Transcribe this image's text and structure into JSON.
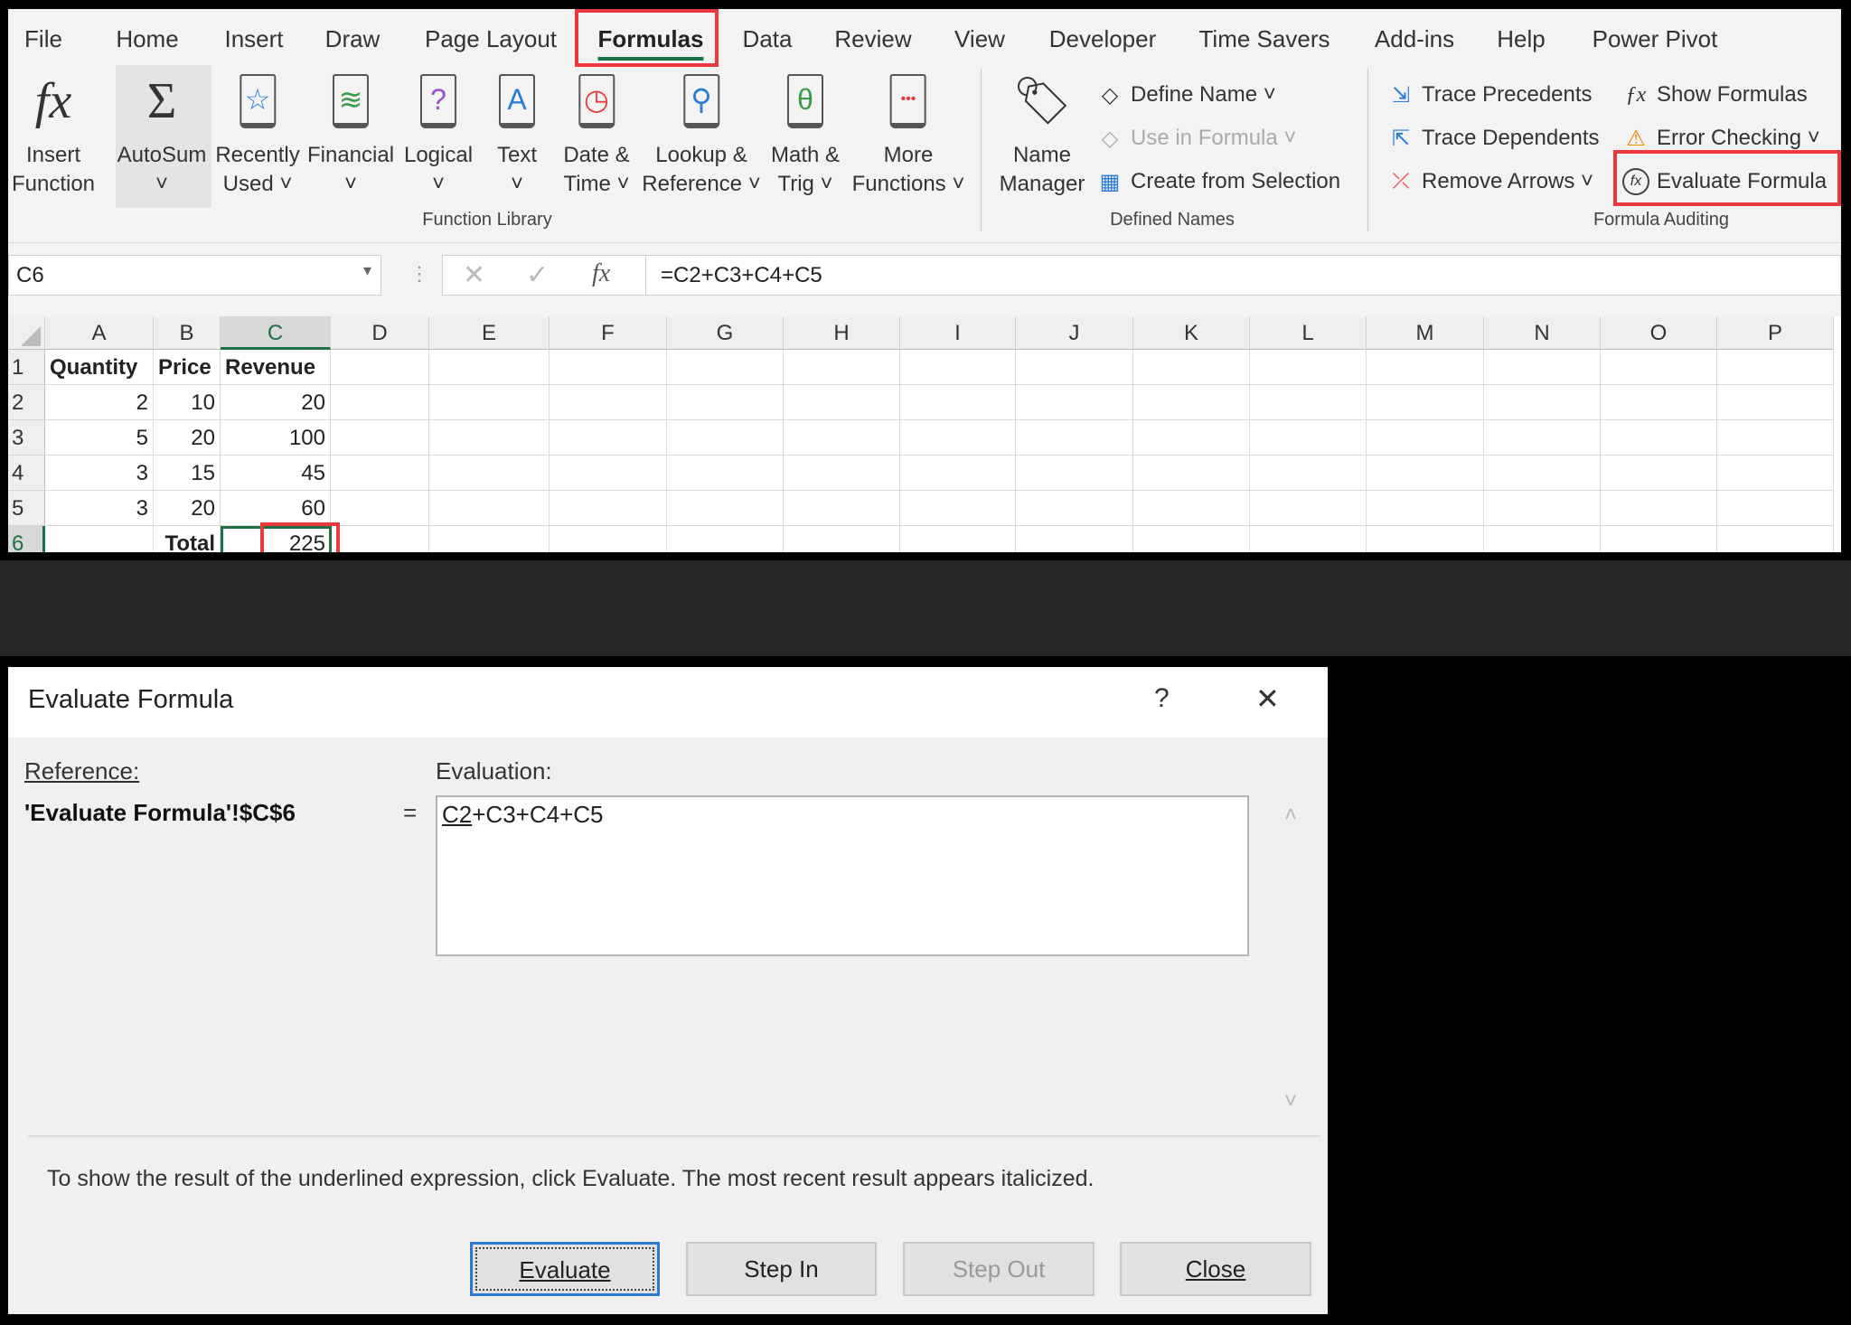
{
  "ribbon_tabs": [
    "File",
    "Home",
    "Insert",
    "Draw",
    "Page Layout",
    "Formulas",
    "Data",
    "Review",
    "View",
    "Developer",
    "Time Savers",
    "Add-ins",
    "Help",
    "Power Pivot"
  ],
  "active_tab": "Formulas",
  "function_library": {
    "group_label": "Function Library",
    "buttons": [
      {
        "l1": "Insert",
        "l2": "Function",
        "icon": "fx-icon"
      },
      {
        "l1": "AutoSum",
        "l2": "˅",
        "icon": "sigma-icon"
      },
      {
        "l1": "Recently",
        "l2": "Used ˅",
        "icon": "star-book-icon"
      },
      {
        "l1": "Financial",
        "l2": "˅",
        "icon": "coins-book-icon"
      },
      {
        "l1": "Logical",
        "l2": "˅",
        "icon": "question-book-icon"
      },
      {
        "l1": "Text",
        "l2": "˅",
        "icon": "text-book-icon"
      },
      {
        "l1": "Date &",
        "l2": "Time ˅",
        "icon": "clock-book-icon"
      },
      {
        "l1": "Lookup &",
        "l2": "Reference ˅",
        "icon": "magnifier-book-icon"
      },
      {
        "l1": "Math &",
        "l2": "Trig ˅",
        "icon": "theta-book-icon"
      },
      {
        "l1": "More",
        "l2": "Functions ˅",
        "icon": "dots-book-icon"
      }
    ]
  },
  "defined_names": {
    "group_label": "Defined Names",
    "name_manager": {
      "l1": "Name",
      "l2": "Manager"
    },
    "define_name": "Define Name ˅",
    "use_in_formula": "Use in Formula ˅",
    "create_from_selection": "Create from Selection"
  },
  "formula_auditing": {
    "group_label": "Formula Auditing",
    "trace_precedents": "Trace Precedents",
    "trace_dependents": "Trace Dependents",
    "remove_arrows": "Remove Arrows ˅",
    "show_formulas": "Show Formulas",
    "error_checking": "Error Checking ˅",
    "evaluate_formula": "Evaluate Formula"
  },
  "name_box": "C6",
  "formula": "=C2+C3+C4+C5",
  "columns": [
    "A",
    "B",
    "C",
    "D",
    "E",
    "F",
    "G",
    "H",
    "I",
    "J",
    "K",
    "L",
    "M",
    "N",
    "O",
    "P"
  ],
  "selected_column": "C",
  "rows": [
    {
      "n": "1",
      "cells": [
        "Quantity",
        "Price",
        "Revenue"
      ]
    },
    {
      "n": "2",
      "cells": [
        "2",
        "10",
        "20"
      ]
    },
    {
      "n": "3",
      "cells": [
        "5",
        "20",
        "100"
      ]
    },
    {
      "n": "4",
      "cells": [
        "3",
        "15",
        "45"
      ]
    },
    {
      "n": "5",
      "cells": [
        "3",
        "20",
        "60"
      ]
    },
    {
      "n": "6",
      "cells": [
        "",
        "Total",
        "225"
      ]
    }
  ],
  "dialog": {
    "title": "Evaluate Formula",
    "help": "?",
    "close_x": "✕",
    "reference_label": "Reference:",
    "reference_value": "'Evaluate Formula'!$C$6",
    "equals": "=",
    "evaluation_label": "Evaluation:",
    "evaluation_underlined": "C2",
    "evaluation_rest": "+C3+C4+C5",
    "message": "To show the result of the underlined expression, click Evaluate.  The most recent result appears italicized.",
    "buttons": {
      "evaluate": "Evaluate",
      "step_in": "Step In",
      "step_out": "Step Out",
      "close": "Close"
    }
  },
  "colors": {
    "accent": "#1e7145",
    "highlight": "#e8393f",
    "focus": "#2a7bd4"
  }
}
